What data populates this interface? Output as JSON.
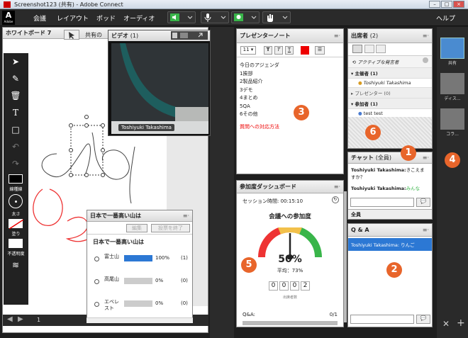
{
  "window": {
    "title": "Screenshot123 (共有) - Adobe Connect",
    "logo": "A",
    "logo_sub": "Adobe"
  },
  "menu": {
    "items": [
      "会議",
      "レイアウト",
      "ポッド",
      "オーディオ"
    ],
    "help": "ヘルプ"
  },
  "whiteboard": {
    "title": "ホワイトボード 7",
    "share_label": "共有の",
    "page": "1",
    "tool_labels": {
      "line": "線種線",
      "thickness": "太さ",
      "fill": "塗り",
      "opacity": "不透明度"
    }
  },
  "video": {
    "title": "ビデオ",
    "count": "(1)",
    "name": "Toshiyuki Takashima"
  },
  "poll": {
    "title": "日本で一番高い山は",
    "edit": "編集",
    "end": "投票を終了",
    "question": "日本で一番高い山は",
    "options": [
      {
        "label": "富士山",
        "pct": "100%",
        "count": "(1)",
        "value": 1.0
      },
      {
        "label": "高尾山",
        "pct": "0%",
        "count": "(0)",
        "value": 0
      },
      {
        "label": "エベレスト",
        "pct": "0%",
        "count": "(0)",
        "value": 0
      }
    ]
  },
  "notes": {
    "title": "プレゼンターノート",
    "font_size": "11",
    "lines": [
      "今日のアジェンダ",
      "1挨拶",
      "2製品紹介",
      "3デモ",
      "4まとめ",
      "5QA",
      "6その他"
    ],
    "red_line": "質問への対応方法"
  },
  "engagement": {
    "title": "参加度ダッシュボード",
    "session_label": "セッション時間:",
    "session_time": "00:15:10",
    "gauge_title": "会議への参加度",
    "percent": "50%",
    "percent_value": 50,
    "avg": "平均：73%",
    "digits": [
      "0",
      "0",
      "0",
      "2"
    ],
    "attendee_label": "出席者数",
    "qa_label": "Q&A:",
    "qa_count": "0/1"
  },
  "attendees": {
    "title": "出席者",
    "count": "(2)",
    "active_label": "アクティブな発言者",
    "hosts_label": "主催者 (1)",
    "host_name": "Toshiyuki Takashima",
    "presenters_label": "プレゼンター (0)",
    "participants_label": "参加者 (1)",
    "participant_name": "test test"
  },
  "chat": {
    "title": "チャット",
    "scope": "(全員)",
    "messages": [
      {
        "sender": "Toshiyuki Takashima:",
        "text": "きこえますか？"
      },
      {
        "sender": "Toshiyuki Takashima:",
        "text": "みんな"
      }
    ],
    "tab": "全員"
  },
  "qa": {
    "title": "Q & A",
    "item": "Toshiyuki Takashima: りんご"
  },
  "sidebar": {
    "items": [
      "共有",
      "ディス...",
      "コラ..."
    ]
  },
  "badges": [
    "1",
    "2",
    "3",
    "4",
    "5",
    "6"
  ],
  "colors": {
    "accent": "#e8652b",
    "green": "#39b54a",
    "red": "#e00000",
    "blue": "#2c78d4"
  }
}
